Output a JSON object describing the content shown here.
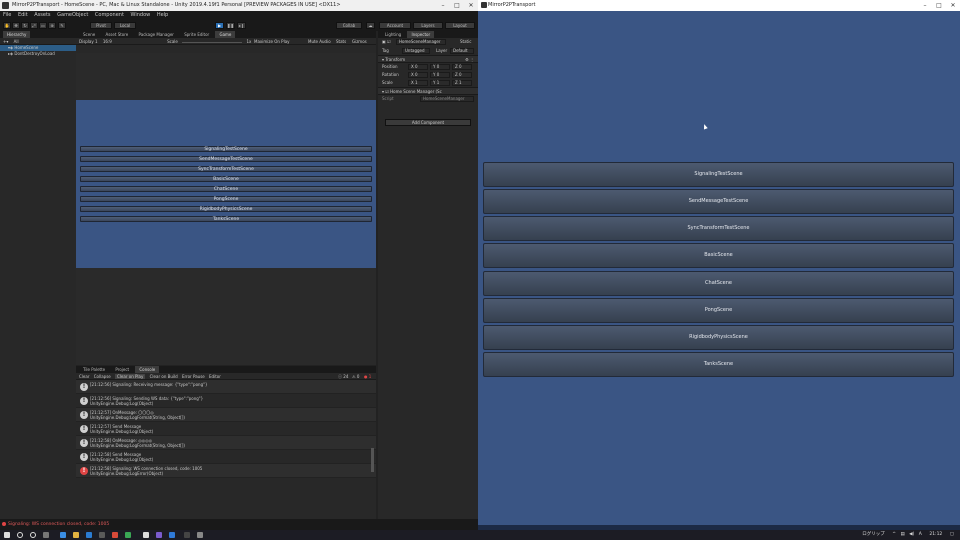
{
  "unity": {
    "title": "MirrorP2PTransport - HomeScene - PC, Mac & Linux Standalone - Unity 2019.4.19f1 Personal [PREVIEW PACKAGES IN USE] <DX11>",
    "menu": [
      "File",
      "Edit",
      "Assets",
      "GameObject",
      "Component",
      "Window",
      "Help"
    ],
    "toolbar": {
      "collab": "Collab",
      "account": "Account",
      "layers": "Layers",
      "layout": "Layout",
      "pivot": "Pivot",
      "local": "Local"
    },
    "hierarchy": {
      "tab": "Hierarchy",
      "search_placeholder": "All",
      "rows": [
        "HomeScene",
        "DontDestroyOnLoad"
      ]
    },
    "game": {
      "tabs": [
        "Scene",
        "Asset Store",
        "Package Manager",
        "Sprite Editor",
        "Game"
      ],
      "display": "Display 1",
      "aspect": "16:9",
      "scale_label": "Scale",
      "scale_value": "1x",
      "options": [
        "Maximize On Play",
        "Mute Audio",
        "Stats",
        "Gizmos"
      ],
      "buttons": [
        "SignalingTestScene",
        "SendMessageTestScene",
        "SyncTransformTestScene",
        "BasicScene",
        "ChatScene",
        "PongScene",
        "RigidbodyPhysicsScene",
        "TanksScene"
      ]
    },
    "console": {
      "tabs": [
        "Tile Palette",
        "Project",
        "Console"
      ],
      "toolbar": [
        "Clear",
        "Collapse",
        "Clear on Play",
        "Clear on Build",
        "Error Pause",
        "Editor"
      ],
      "counts": {
        "info": "24",
        "warn": "0",
        "error": "1"
      },
      "logs": [
        {
          "line1": "[21:12:56] Signaling: Receiving message: {\"type\":\"pong\"}",
          "line2": "",
          "level": "info"
        },
        {
          "line1": "[21:12:56] Signaling: Sending WS data: {\"type\":\"pong\"}",
          "line2": "UnityEngine.Debug:Log(Object)",
          "level": "info"
        },
        {
          "line1": "[21:12:57] OnMessage: 〇〇〇◎",
          "line2": "UnityEngine.Debug:LogFormat(String, Object[])",
          "level": "info"
        },
        {
          "line1": "[21:12:57] Send Message",
          "line2": "UnityEngine.Debug:Log(Object)",
          "level": "info"
        },
        {
          "line1": "[21:12:58] OnMessage: ◎◎◎◎",
          "line2": "UnityEngine.Debug:LogFormat(String, Object[])",
          "level": "info"
        },
        {
          "line1": "[21:12:58] Send Message",
          "line2": "UnityEngine.Debug:Log(Object)",
          "level": "info"
        },
        {
          "line1": "[21:12:58] Signaling: WS connection closed, code: 1005",
          "line2": "UnityEngine.Debug:LogError(Object)",
          "level": "error"
        }
      ]
    },
    "inspector": {
      "tabs": [
        "Lighting",
        "Inspector"
      ],
      "object_name": "HomeSceneManager",
      "static_label": "Static",
      "tag_label": "Tag",
      "tag_value": "Untagged",
      "layer_label": "Layer",
      "layer_value": "Default",
      "transform_label": "Transform",
      "rows": [
        {
          "label": "Position",
          "x": "0",
          "y": "0",
          "z": "0"
        },
        {
          "label": "Rotation",
          "x": "0",
          "y": "0",
          "z": "0"
        },
        {
          "label": "Scale",
          "x": "1",
          "y": "1",
          "z": "1"
        }
      ],
      "component_label": "Home Scene Manager (Sc",
      "script_label": "Script",
      "script_value": "HomeSceneManager",
      "add_component": "Add Component"
    },
    "status": "Signaling: WS connection closed, code: 1005"
  },
  "player": {
    "title": "MirrorP2PTransport",
    "buttons": [
      "SignalingTestScene",
      "SendMessageTestScene",
      "SyncTransformTestScene",
      "BasicScene",
      "ChatScene",
      "PongScene",
      "RigidbodyPhysicsScene",
      "TanksScene"
    ]
  },
  "taskbar": {
    "tray_text": "ログリップ",
    "clock": "21:12"
  },
  "colors": {
    "game_bg": "#3a5584",
    "play_blue": "#2b6fb3",
    "error": "#e04545"
  }
}
